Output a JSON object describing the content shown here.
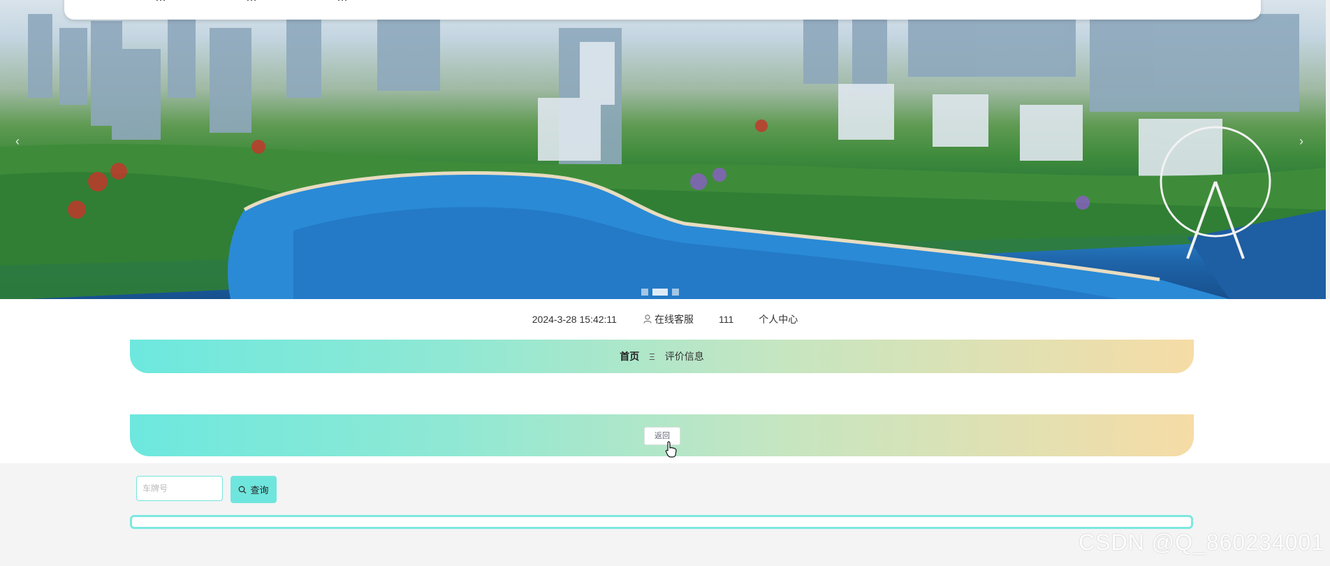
{
  "nav": {
    "items": [
      "…",
      "…",
      "…"
    ]
  },
  "carousel": {
    "slide_count": 3,
    "active_slide": 2,
    "prev_icon": "chevron-left-icon",
    "next_icon": "chevron-right-icon"
  },
  "info": {
    "datetime": "2024-3-28 15:42:11",
    "service_icon": "user-icon",
    "service_label": "在线客服",
    "username": "111",
    "personal_center": "个人中心"
  },
  "breadcrumb": {
    "home": "首页",
    "separator": "Ξ",
    "current": "评价信息"
  },
  "detail": {
    "back_label": "返回"
  },
  "search": {
    "placeholder": "车牌号",
    "button_label": "查询",
    "button_icon": "search-icon"
  },
  "watermark": "CSDN @Q_860234001",
  "colors": {
    "accent": "#6fe6dd",
    "gradient_end": "#f6dca6"
  }
}
